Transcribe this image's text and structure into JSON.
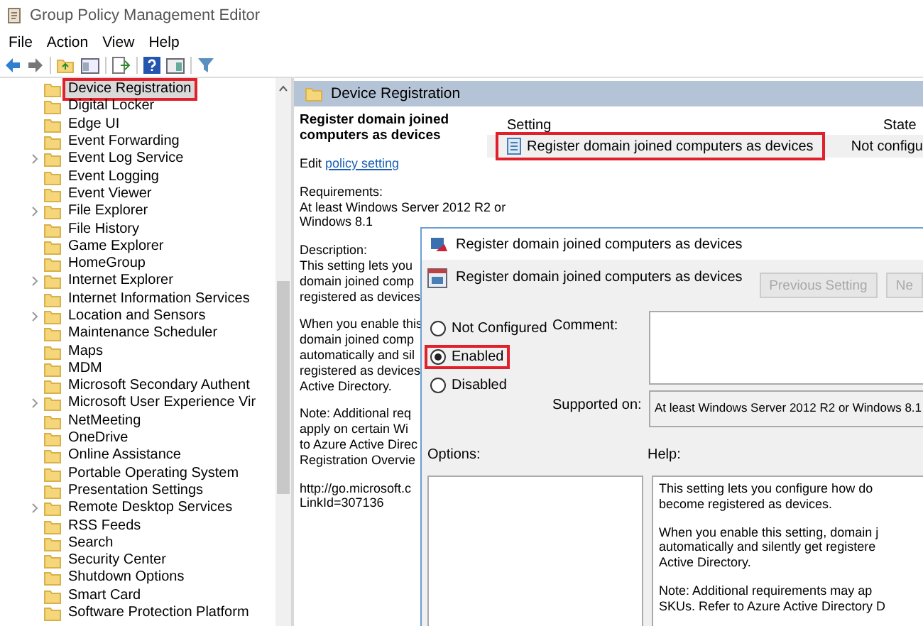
{
  "window": {
    "title": "Group Policy Management Editor"
  },
  "menu": [
    "File",
    "Action",
    "View",
    "Help"
  ],
  "tree": {
    "items": [
      {
        "label": "Device Registration",
        "expandable": false,
        "selected": true,
        "highlighted": true
      },
      {
        "label": "Digital Locker",
        "expandable": false,
        "selected": false,
        "highlighted": false
      },
      {
        "label": "Edge UI",
        "expandable": false,
        "selected": false,
        "highlighted": false
      },
      {
        "label": "Event Forwarding",
        "expandable": false,
        "selected": false,
        "highlighted": false
      },
      {
        "label": "Event Log Service",
        "expandable": true,
        "selected": false,
        "highlighted": false
      },
      {
        "label": "Event Logging",
        "expandable": false,
        "selected": false,
        "highlighted": false
      },
      {
        "label": "Event Viewer",
        "expandable": false,
        "selected": false,
        "highlighted": false
      },
      {
        "label": "File Explorer",
        "expandable": true,
        "selected": false,
        "highlighted": false
      },
      {
        "label": "File History",
        "expandable": false,
        "selected": false,
        "highlighted": false
      },
      {
        "label": "Game Explorer",
        "expandable": false,
        "selected": false,
        "highlighted": false
      },
      {
        "label": "HomeGroup",
        "expandable": false,
        "selected": false,
        "highlighted": false
      },
      {
        "label": "Internet Explorer",
        "expandable": true,
        "selected": false,
        "highlighted": false
      },
      {
        "label": "Internet Information Services",
        "expandable": false,
        "selected": false,
        "highlighted": false
      },
      {
        "label": "Location and Sensors",
        "expandable": true,
        "selected": false,
        "highlighted": false
      },
      {
        "label": "Maintenance Scheduler",
        "expandable": false,
        "selected": false,
        "highlighted": false
      },
      {
        "label": "Maps",
        "expandable": false,
        "selected": false,
        "highlighted": false
      },
      {
        "label": "MDM",
        "expandable": false,
        "selected": false,
        "highlighted": false
      },
      {
        "label": "Microsoft Secondary Authent",
        "expandable": false,
        "selected": false,
        "highlighted": false
      },
      {
        "label": "Microsoft User Experience Vir",
        "expandable": true,
        "selected": false,
        "highlighted": false
      },
      {
        "label": "NetMeeting",
        "expandable": false,
        "selected": false,
        "highlighted": false
      },
      {
        "label": "OneDrive",
        "expandable": false,
        "selected": false,
        "highlighted": false
      },
      {
        "label": "Online Assistance",
        "expandable": false,
        "selected": false,
        "highlighted": false
      },
      {
        "label": "Portable Operating System",
        "expandable": false,
        "selected": false,
        "highlighted": false
      },
      {
        "label": "Presentation Settings",
        "expandable": false,
        "selected": false,
        "highlighted": false
      },
      {
        "label": "Remote Desktop Services",
        "expandable": true,
        "selected": false,
        "highlighted": false
      },
      {
        "label": "RSS Feeds",
        "expandable": false,
        "selected": false,
        "highlighted": false
      },
      {
        "label": "Search",
        "expandable": false,
        "selected": false,
        "highlighted": false
      },
      {
        "label": "Security Center",
        "expandable": false,
        "selected": false,
        "highlighted": false
      },
      {
        "label": "Shutdown Options",
        "expandable": false,
        "selected": false,
        "highlighted": false
      },
      {
        "label": "Smart Card",
        "expandable": false,
        "selected": false,
        "highlighted": false
      },
      {
        "label": "Software Protection Platform",
        "expandable": false,
        "selected": false,
        "highlighted": false
      }
    ]
  },
  "header": {
    "title": "Device Registration"
  },
  "details": {
    "title": "Register domain joined computers as devices",
    "edit_prefix": "Edit",
    "edit_link": "policy setting",
    "paragraphs": [
      [
        "Requirements:",
        "At least Windows Server 2012 R2 or",
        "Windows 8.1"
      ],
      [
        "Description:",
        "This setting lets you",
        "domain joined comp",
        "registered as devices"
      ],
      [
        "When you enable this",
        "domain joined comp",
        "automatically and sil",
        "registered as devices",
        "Active Directory."
      ],
      [
        "Note: Additional req",
        "apply on certain Wi",
        "to Azure Active Direc",
        "Registration Overvie"
      ],
      [
        "http://go.microsoft.c",
        "LinkId=307136"
      ]
    ]
  },
  "settings_list": {
    "columns": [
      "Setting",
      "State"
    ],
    "rows": [
      {
        "setting": "Register domain joined computers as devices",
        "state": "Not configu",
        "highlighted": true
      }
    ]
  },
  "dialog": {
    "title": "Register domain joined computers as devices",
    "policy_name": "Register domain joined computers as devices",
    "buttons": [
      {
        "label": "Previous Setting",
        "disabled": true
      },
      {
        "label": "Ne",
        "disabled": true
      }
    ],
    "options": [
      {
        "label": "Not Configured",
        "selected": false,
        "highlighted": false
      },
      {
        "label": "Enabled",
        "selected": true,
        "highlighted": true
      },
      {
        "label": "Disabled",
        "selected": false,
        "highlighted": false
      }
    ],
    "comment_label": "Comment:",
    "supported_label": "Supported on:",
    "supported_value": "At least Windows Server 2012 R2 or Windows 8.1",
    "options_label": "Options:",
    "help_label": "Help:",
    "help_paragraphs": [
      [
        "This setting lets you configure how do",
        "become registered as devices."
      ],
      [
        "When you enable this setting, domain j",
        "automatically and silently get registere",
        "Active Directory."
      ],
      [
        "Note: Additional requirements may ap",
        "SKUs. Refer to Azure Active Directory D"
      ]
    ]
  }
}
